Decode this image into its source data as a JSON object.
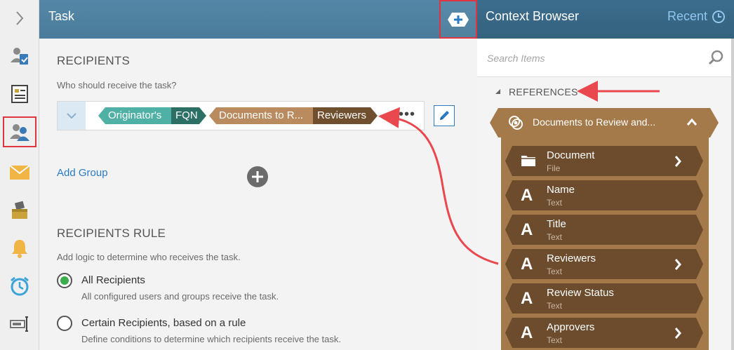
{
  "colors": {
    "task_header": "#5487a7",
    "cb_header": "#3d6d8d",
    "accent_blue": "#2a7bc4",
    "annotation_red": "#e0343e",
    "chip_teal_light": "#4fb1a5",
    "chip_teal_dark": "#2c7065",
    "chip_brown_light": "#b98b5e",
    "chip_brown_dark": "#704f2e",
    "ref_group": "#a47a4a",
    "ref_item": "#6c4c2d",
    "radio_on": "#3aae4a"
  },
  "rail": {
    "icons": [
      "chevron-right-icon",
      "user-check-icon",
      "form-icon",
      "users-icon",
      "mail-icon",
      "inbox-box-icon",
      "bell-icon",
      "alarm-clock-icon",
      "text-field-icon"
    ]
  },
  "task": {
    "title": "Task",
    "recipients": {
      "title": "RECIPIENTS",
      "subtitle": "Who should receive the task?",
      "chips": {
        "originator": "Originator's",
        "fqn": "FQN",
        "documents": "Documents to R...",
        "reviewers": "Reviewers"
      },
      "more": "•••",
      "add_group": "Add Group"
    },
    "rule": {
      "title": "RECIPIENTS RULE",
      "subtitle": "Add logic to determine who receives the task.",
      "options": [
        {
          "label": "All Recipients",
          "desc": "All configured users and groups receive the task.",
          "selected": true
        },
        {
          "label": "Certain Recipients, based on a rule",
          "desc": "Define conditions to determine which recipients receive the task.",
          "selected": false
        }
      ]
    }
  },
  "context_browser": {
    "title": "Context Browser",
    "recent": "Recent",
    "search_placeholder": "Search Items",
    "references_label": "REFERENCES",
    "group": {
      "label": "Documents to Review and...",
      "items": [
        {
          "icon": "folder-icon",
          "name": "Document",
          "type": "File",
          "expandable": true
        },
        {
          "icon": "text-a-icon",
          "glyph": "A",
          "name": "Name",
          "type": "Text",
          "expandable": false
        },
        {
          "icon": "text-a-icon",
          "glyph": "A",
          "name": "Title",
          "type": "Text",
          "expandable": false
        },
        {
          "icon": "text-a-icon",
          "glyph": "A",
          "name": "Reviewers",
          "type": "Text",
          "expandable": true
        },
        {
          "icon": "text-a-icon",
          "glyph": "A",
          "name": "Review Status",
          "type": "Text",
          "expandable": false
        },
        {
          "icon": "text-a-icon",
          "glyph": "A",
          "name": "Approvers",
          "type": "Text",
          "expandable": true
        }
      ]
    }
  }
}
